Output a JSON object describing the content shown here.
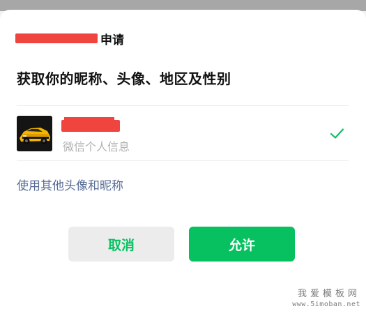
{
  "dialog": {
    "app_name_suffix": "申请",
    "title": "获取你的昵称、头像、地区及性别",
    "profile": {
      "subtitle": "微信个人信息",
      "selected_icon": "checkmark-icon"
    },
    "other_profile_link": "使用其他头像和昵称",
    "buttons": {
      "cancel": "取消",
      "allow": "允许"
    }
  },
  "watermark": {
    "line1": "我爱模板网",
    "line2": "www.5imoban.net"
  },
  "colors": {
    "accent_green": "#07c160",
    "link_blue": "#576b95",
    "redaction_red": "#f0443f"
  }
}
